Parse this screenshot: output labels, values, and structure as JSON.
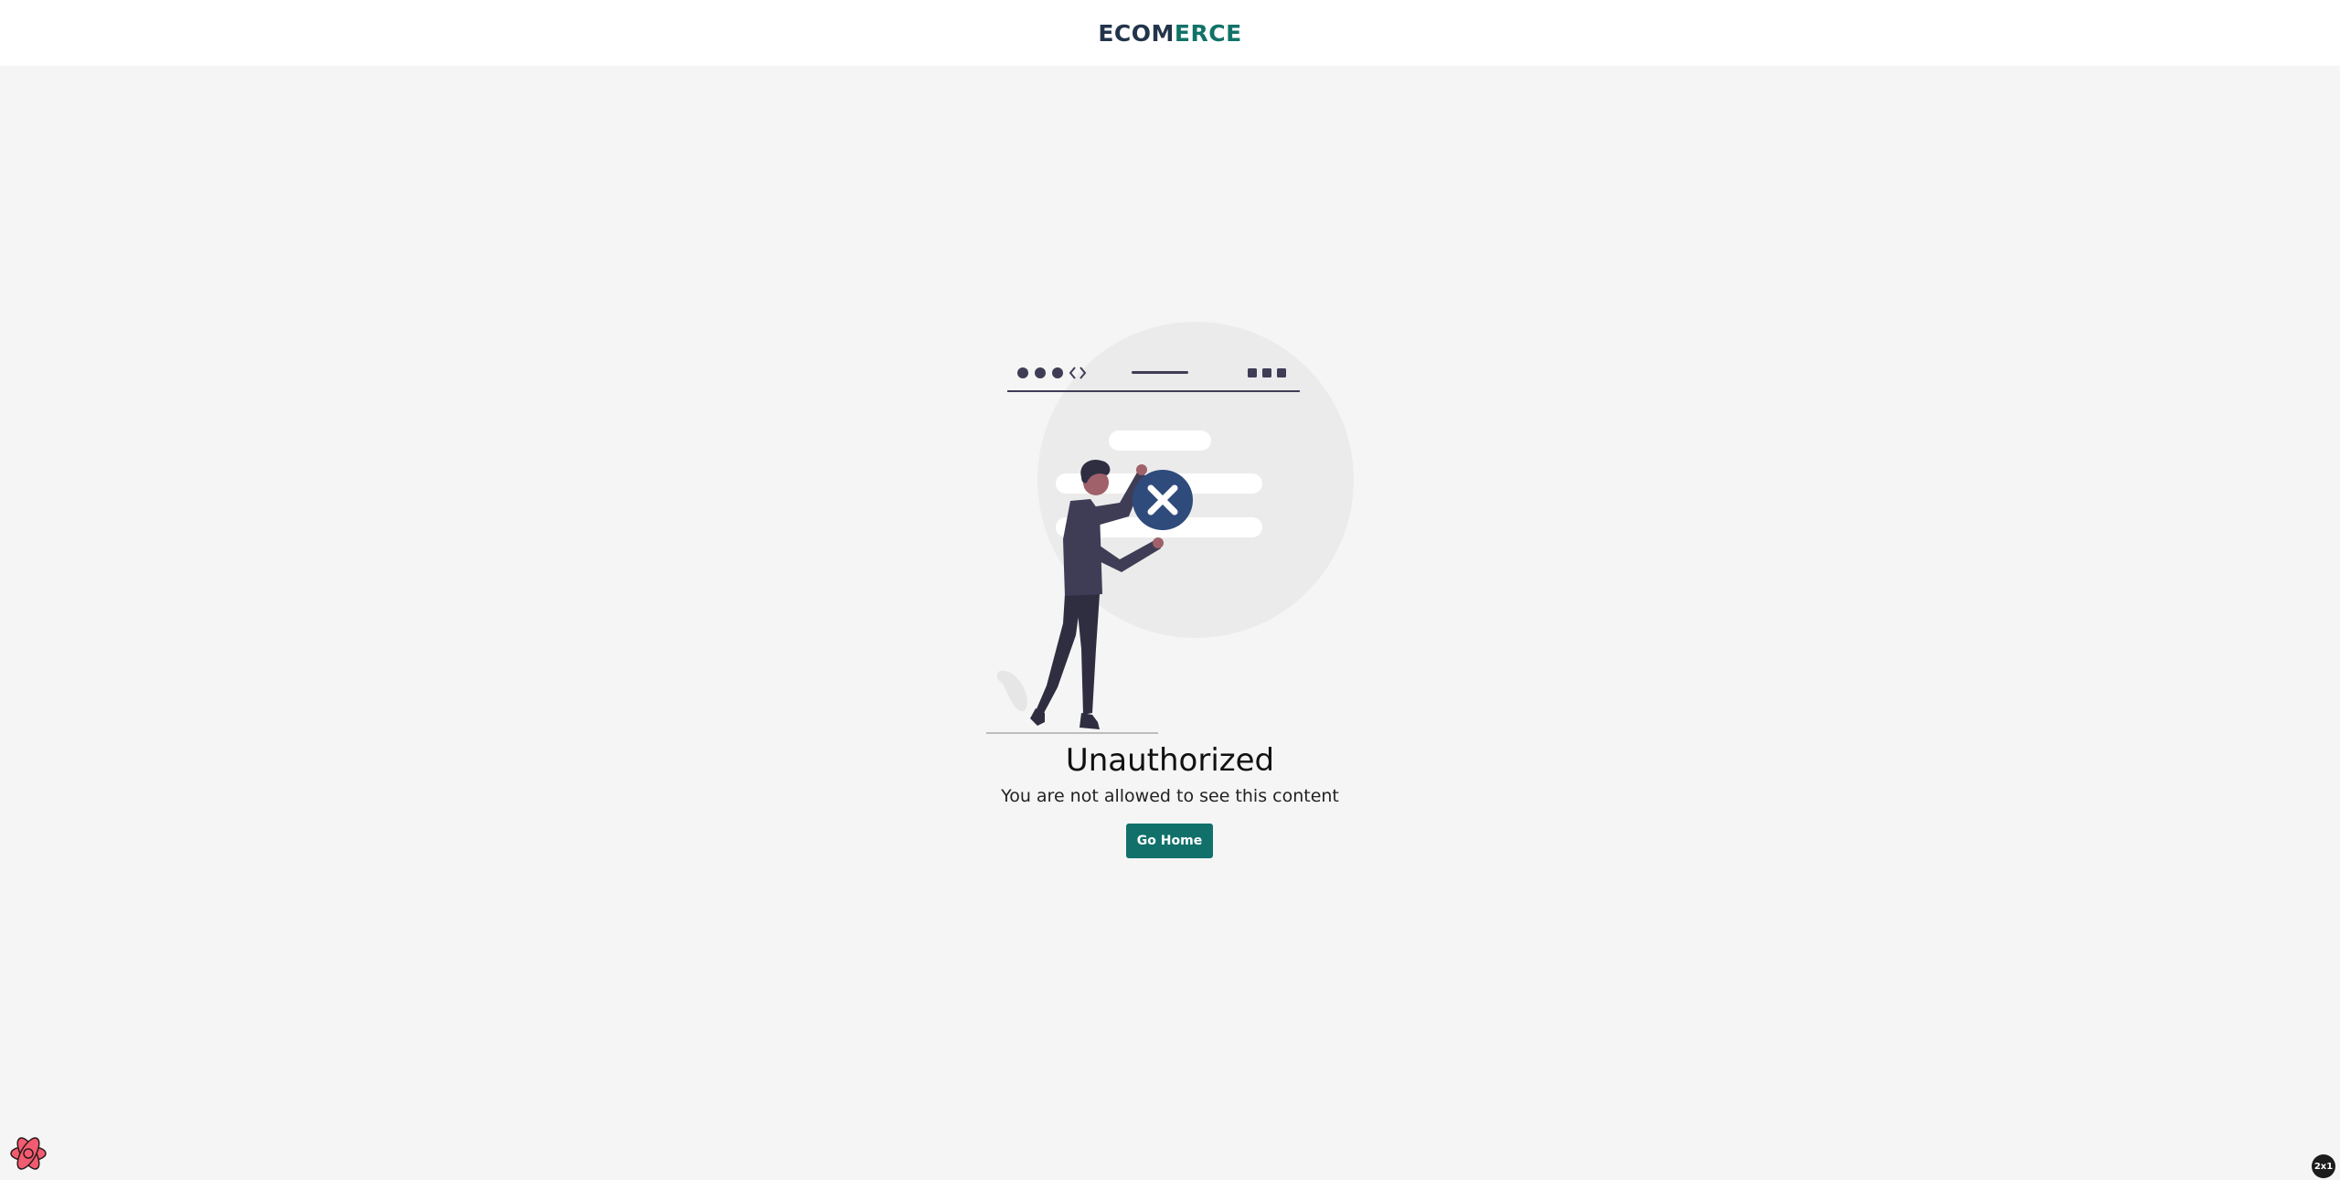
{
  "header": {
    "logo_part1": "ECOM",
    "logo_part2": "ERCE"
  },
  "main": {
    "title": "Unauthorized",
    "message": "You are not allowed to see this content",
    "button_label": "Go Home"
  },
  "devtools": {
    "badge_text": "2x1",
    "icon": "react-devtools-icon"
  },
  "colors": {
    "background": "#f5f5f5",
    "header_bg": "#ffffff",
    "brand_dark": "#22344a",
    "brand_accent": "#117368",
    "button_bg": "#11706a",
    "illustration_dark": "#3f3d56",
    "error_badge": "#2f4b7c"
  }
}
